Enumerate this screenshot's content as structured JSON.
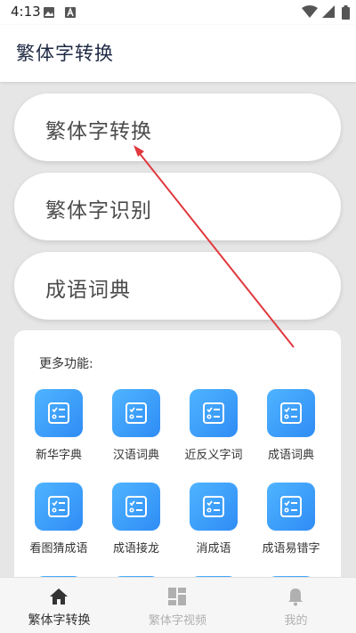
{
  "status_bar": {
    "time": "4:13"
  },
  "app_bar": {
    "title": "繁体字转换"
  },
  "main_buttons": [
    "繁体字转换",
    "繁体字识别",
    "成语词典"
  ],
  "more": {
    "title": "更多功能:",
    "tools": [
      "新华字典",
      "汉语词典",
      "近反义字词",
      "成语词典",
      "看图猜成语",
      "成语接龙",
      "消成语",
      "成语易错字"
    ]
  },
  "bottom_nav": [
    "繁体字转换",
    "繁体字视频",
    "我的"
  ],
  "colors": {
    "accent": "#3a9ff8",
    "arrow": "#e0393e"
  }
}
